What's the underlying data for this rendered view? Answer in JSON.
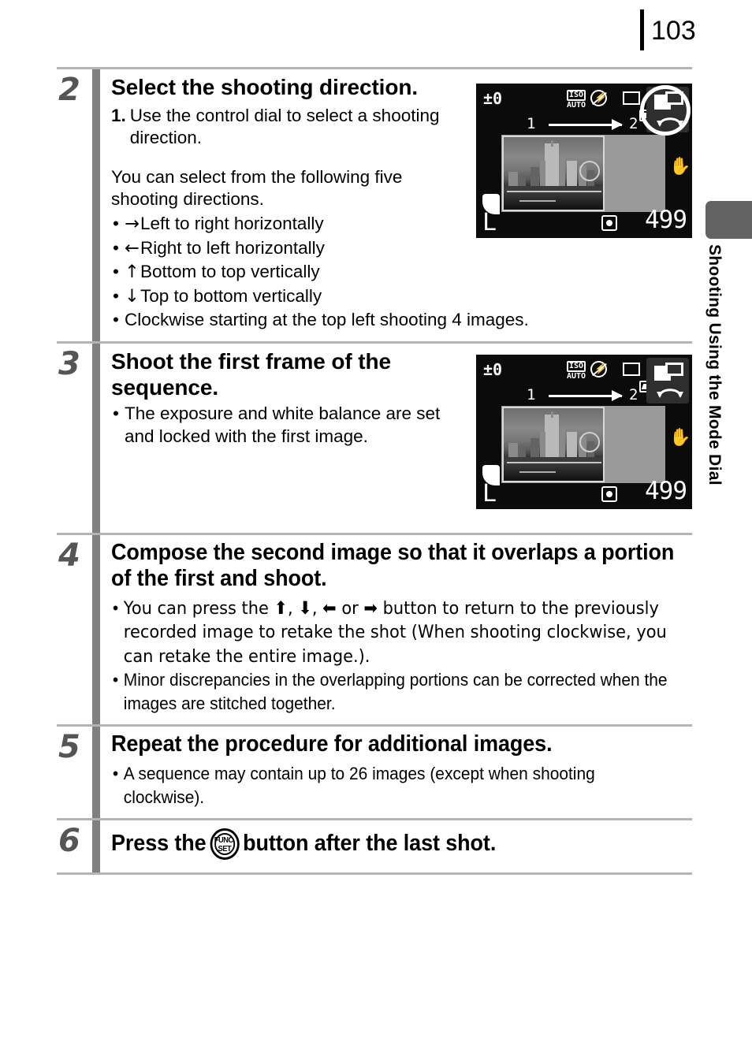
{
  "page": {
    "number": "103",
    "side_tab_label": "Shooting Using the Mode Dial"
  },
  "steps": [
    {
      "number": "2",
      "title": "Select the shooting direction.",
      "numbered_items": [
        {
          "label": "1.",
          "text": "Use the control dial to select a shooting direction."
        }
      ],
      "paragraph": "You can select from the following five shooting directions.",
      "bullets": [
        {
          "glyph": "→",
          "text": "Left to right horizontally"
        },
        {
          "glyph": "←",
          "text": "Right to left horizontally"
        },
        {
          "glyph": "↑",
          "text": "Bottom to top vertically"
        },
        {
          "glyph": "↓",
          "text": "Top to bottom vertically"
        },
        {
          "glyph": "",
          "text": "Clockwise starting at the top left shooting 4 images."
        }
      ]
    },
    {
      "number": "3",
      "title": "Shoot the first frame of the sequence.",
      "bullets": [
        {
          "glyph": "",
          "text": "The exposure and white balance are set and locked with the first image."
        }
      ]
    },
    {
      "number": "4",
      "title": "Compose the second image so that it overlaps a portion of the first and shoot.",
      "bullets": [
        {
          "glyph": "",
          "text": "You can press the ⬆, ⬇, ⬅ or ➡ button to return to the previously recorded image to retake the shot (When shooting clockwise, you can retake the entire image.)."
        },
        {
          "glyph": "",
          "text": "Minor discrepancies in the overlapping portions can be corrected when the images are stitched together."
        }
      ]
    },
    {
      "number": "5",
      "title": "Repeat the procedure for additional images.",
      "bullets": [
        {
          "glyph": "",
          "text": "A sequence may contain up to 26 images (except when shooting clockwise)."
        }
      ]
    },
    {
      "number": "6",
      "title_before": "Press the",
      "title_icon": "func-set-button",
      "title_after": "button after the last shot.",
      "icon_labels": {
        "top": "FUNC.",
        "bottom": "SET"
      }
    }
  ],
  "lcd": {
    "exposure_compensation": "±0",
    "iso_label": "ISO",
    "iso_value": "AUTO",
    "flash_icon": "flash-off-icon",
    "drive_icon": "single-shot-icon",
    "camera_icon": "camera-icon",
    "battery_icon": "battery-icon",
    "stitch_assist_icon": "stitch-assist-icon",
    "control_dial_icon": "control-dial-icon",
    "sequence_from": "1",
    "sequence_to": "2",
    "direction_arrow": "arrow-right-icon",
    "image_quality": "L",
    "metering_icon": "evaluative-metering-icon",
    "shots_remaining": "499",
    "image_stabilizer_icon": "image-stabilizer-icon",
    "highlight": "highlight-ellipse"
  },
  "colors": {
    "rule": "#b4b4b4",
    "step_bar": "#808080",
    "step_number": "#555555",
    "side_tab": "#636363",
    "lcd_background": "#0b0b0b",
    "lcd_panel": "#9a9a9a"
  }
}
